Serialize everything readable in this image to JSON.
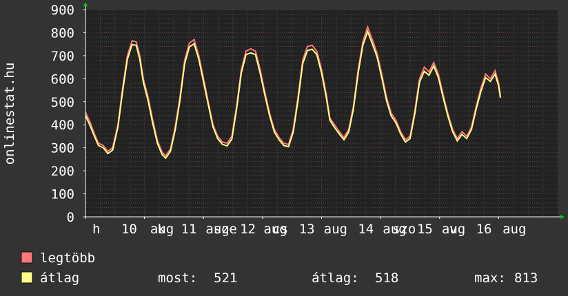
{
  "colors": {
    "background": "#333333",
    "plot_background": "#222222",
    "grid_minor": "#4a4a4a",
    "grid_major": "#6a3a3a",
    "text": "#ffffff",
    "axis_arrow": "#00cc00",
    "series_max": "#ff7777",
    "series_avg": "#ffff88"
  },
  "stats": {
    "most_label": "most:",
    "most_value": "521",
    "avg_label": "átlag:",
    "avg_value": "518",
    "max_label": "max:",
    "max_value": "813"
  },
  "chart_data": {
    "type": "line",
    "title": "",
    "xlabel": "",
    "ylabel": "onlinestat.hu",
    "ylim": [
      0,
      900
    ],
    "yticks": [
      0,
      100,
      200,
      300,
      400,
      500,
      600,
      700,
      800,
      900
    ],
    "grid": true,
    "legend_position": "bottom-left",
    "x_domain": [
      0,
      8.0
    ],
    "x_tick_labels": [
      {
        "x": 0.0,
        "label": "h"
      },
      {
        "x": 0.49,
        "label": "10"
      },
      {
        "x": 0.98,
        "label": "aug"
      },
      {
        "x": 1.1,
        "label": "k"
      },
      {
        "x": 1.5,
        "label": "11"
      },
      {
        "x": 1.92,
        "label": "aug"
      },
      {
        "x": 2.05,
        "label": "sze"
      },
      {
        "x": 2.5,
        "label": "12"
      },
      {
        "x": 2.9,
        "label": "aug"
      },
      {
        "x": 3.05,
        "label": "cs"
      },
      {
        "x": 3.5,
        "label": "13"
      },
      {
        "x": 3.92,
        "label": "aug"
      },
      {
        "x": 4.5,
        "label": "14"
      },
      {
        "x": 4.92,
        "label": "aug"
      },
      {
        "x": 5.08,
        "label": "szo"
      },
      {
        "x": 5.5,
        "label": "15"
      },
      {
        "x": 5.92,
        "label": "aug"
      },
      {
        "x": 6.05,
        "label": "v"
      },
      {
        "x": 6.5,
        "label": "16"
      },
      {
        "x": 6.95,
        "label": "aug"
      }
    ],
    "series": [
      {
        "name": "legtöbb",
        "color": "#ff7777",
        "points": [
          [
            0.0,
            455
          ],
          [
            0.08,
            410
          ],
          [
            0.16,
            355
          ],
          [
            0.22,
            320
          ],
          [
            0.3,
            310
          ],
          [
            0.38,
            285
          ],
          [
            0.46,
            300
          ],
          [
            0.55,
            400
          ],
          [
            0.63,
            560
          ],
          [
            0.71,
            700
          ],
          [
            0.79,
            765
          ],
          [
            0.86,
            760
          ],
          [
            0.92,
            700
          ],
          [
            0.98,
            600
          ],
          [
            1.06,
            520
          ],
          [
            1.14,
            420
          ],
          [
            1.22,
            330
          ],
          [
            1.3,
            280
          ],
          [
            1.36,
            265
          ],
          [
            1.44,
            295
          ],
          [
            1.52,
            390
          ],
          [
            1.6,
            520
          ],
          [
            1.68,
            680
          ],
          [
            1.76,
            755
          ],
          [
            1.84,
            770
          ],
          [
            1.92,
            700
          ],
          [
            2.0,
            600
          ],
          [
            2.08,
            500
          ],
          [
            2.16,
            400
          ],
          [
            2.24,
            350
          ],
          [
            2.32,
            325
          ],
          [
            2.4,
            320
          ],
          [
            2.48,
            350
          ],
          [
            2.56,
            480
          ],
          [
            2.64,
            640
          ],
          [
            2.72,
            720
          ],
          [
            2.8,
            730
          ],
          [
            2.88,
            720
          ],
          [
            2.96,
            640
          ],
          [
            3.04,
            540
          ],
          [
            3.12,
            450
          ],
          [
            3.2,
            380
          ],
          [
            3.28,
            345
          ],
          [
            3.36,
            320
          ],
          [
            3.44,
            315
          ],
          [
            3.52,
            380
          ],
          [
            3.6,
            520
          ],
          [
            3.68,
            680
          ],
          [
            3.76,
            740
          ],
          [
            3.84,
            745
          ],
          [
            3.92,
            720
          ],
          [
            4.0,
            640
          ],
          [
            4.08,
            530
          ],
          [
            4.14,
            430
          ],
          [
            4.22,
            400
          ],
          [
            4.3,
            370
          ],
          [
            4.38,
            345
          ],
          [
            4.46,
            380
          ],
          [
            4.54,
            480
          ],
          [
            4.62,
            640
          ],
          [
            4.7,
            760
          ],
          [
            4.78,
            825
          ],
          [
            4.86,
            770
          ],
          [
            4.94,
            710
          ],
          [
            5.02,
            620
          ],
          [
            5.1,
            520
          ],
          [
            5.18,
            450
          ],
          [
            5.26,
            420
          ],
          [
            5.34,
            370
          ],
          [
            5.42,
            335
          ],
          [
            5.5,
            350
          ],
          [
            5.58,
            460
          ],
          [
            5.66,
            600
          ],
          [
            5.74,
            650
          ],
          [
            5.82,
            630
          ],
          [
            5.9,
            670
          ],
          [
            5.98,
            620
          ],
          [
            6.06,
            530
          ],
          [
            6.14,
            450
          ],
          [
            6.22,
            380
          ],
          [
            6.3,
            340
          ],
          [
            6.38,
            370
          ],
          [
            6.46,
            350
          ],
          [
            6.54,
            390
          ],
          [
            6.62,
            480
          ],
          [
            6.7,
            560
          ],
          [
            6.78,
            620
          ],
          [
            6.86,
            600
          ],
          [
            6.94,
            635
          ],
          [
            7.0,
            580
          ],
          [
            7.03,
            525
          ]
        ]
      },
      {
        "name": "átlag",
        "color": "#ffff88",
        "points": [
          [
            0.0,
            440
          ],
          [
            0.08,
            395
          ],
          [
            0.16,
            345
          ],
          [
            0.22,
            310
          ],
          [
            0.3,
            300
          ],
          [
            0.38,
            275
          ],
          [
            0.46,
            290
          ],
          [
            0.55,
            390
          ],
          [
            0.63,
            545
          ],
          [
            0.71,
            685
          ],
          [
            0.79,
            748
          ],
          [
            0.86,
            745
          ],
          [
            0.92,
            685
          ],
          [
            0.98,
            585
          ],
          [
            1.06,
            505
          ],
          [
            1.14,
            405
          ],
          [
            1.22,
            318
          ],
          [
            1.3,
            270
          ],
          [
            1.36,
            255
          ],
          [
            1.44,
            285
          ],
          [
            1.52,
            378
          ],
          [
            1.6,
            505
          ],
          [
            1.68,
            665
          ],
          [
            1.76,
            738
          ],
          [
            1.84,
            752
          ],
          [
            1.92,
            685
          ],
          [
            2.0,
            585
          ],
          [
            2.08,
            488
          ],
          [
            2.16,
            390
          ],
          [
            2.24,
            340
          ],
          [
            2.32,
            315
          ],
          [
            2.4,
            308
          ],
          [
            2.48,
            338
          ],
          [
            2.56,
            468
          ],
          [
            2.64,
            625
          ],
          [
            2.72,
            705
          ],
          [
            2.8,
            712
          ],
          [
            2.88,
            705
          ],
          [
            2.96,
            625
          ],
          [
            3.04,
            528
          ],
          [
            3.12,
            438
          ],
          [
            3.2,
            368
          ],
          [
            3.28,
            335
          ],
          [
            3.36,
            310
          ],
          [
            3.44,
            305
          ],
          [
            3.52,
            368
          ],
          [
            3.6,
            505
          ],
          [
            3.68,
            665
          ],
          [
            3.76,
            722
          ],
          [
            3.84,
            728
          ],
          [
            3.92,
            705
          ],
          [
            4.0,
            625
          ],
          [
            4.08,
            518
          ],
          [
            4.14,
            420
          ],
          [
            4.22,
            388
          ],
          [
            4.3,
            360
          ],
          [
            4.38,
            335
          ],
          [
            4.46,
            368
          ],
          [
            4.54,
            468
          ],
          [
            4.62,
            625
          ],
          [
            4.7,
            745
          ],
          [
            4.78,
            805
          ],
          [
            4.86,
            752
          ],
          [
            4.94,
            695
          ],
          [
            5.02,
            605
          ],
          [
            5.1,
            505
          ],
          [
            5.18,
            438
          ],
          [
            5.26,
            408
          ],
          [
            5.34,
            360
          ],
          [
            5.42,
            325
          ],
          [
            5.5,
            340
          ],
          [
            5.58,
            448
          ],
          [
            5.66,
            585
          ],
          [
            5.74,
            632
          ],
          [
            5.82,
            615
          ],
          [
            5.9,
            655
          ],
          [
            5.98,
            605
          ],
          [
            6.06,
            518
          ],
          [
            6.14,
            438
          ],
          [
            6.22,
            370
          ],
          [
            6.3,
            330
          ],
          [
            6.38,
            358
          ],
          [
            6.46,
            340
          ],
          [
            6.54,
            380
          ],
          [
            6.62,
            468
          ],
          [
            6.7,
            545
          ],
          [
            6.78,
            605
          ],
          [
            6.86,
            588
          ],
          [
            6.94,
            620
          ],
          [
            7.0,
            568
          ],
          [
            7.03,
            518
          ]
        ]
      }
    ]
  }
}
